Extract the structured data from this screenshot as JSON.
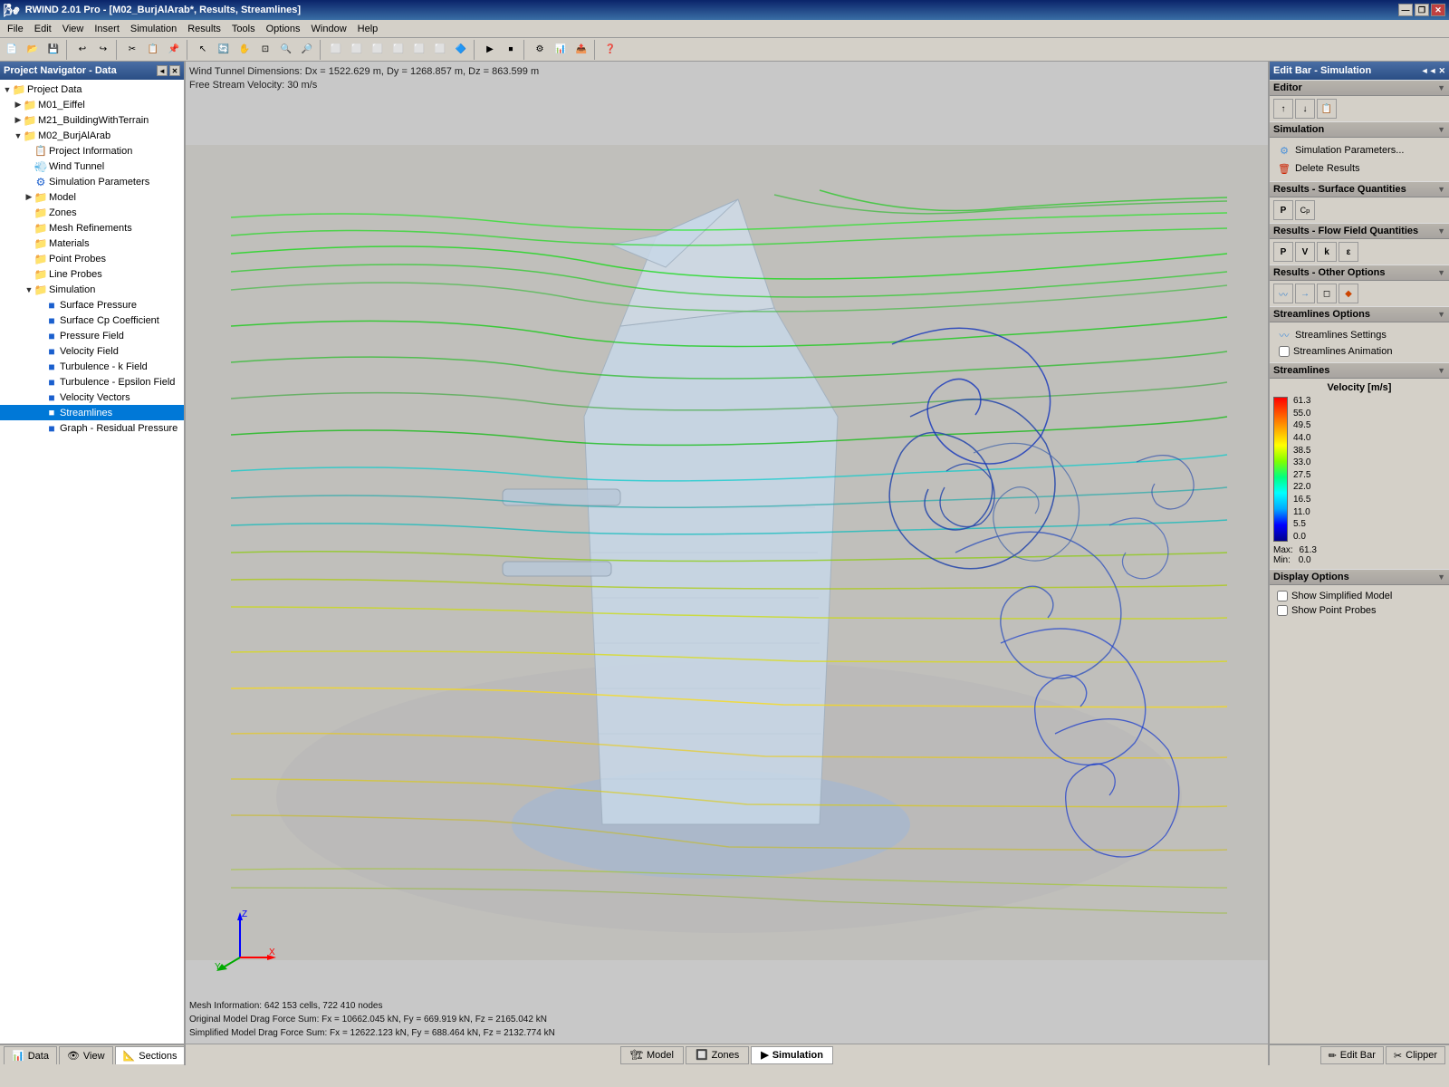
{
  "app": {
    "title": "RWIND 2.01 Pro - [M02_BurjAlArab*, Results, Streamlines]",
    "title_buttons": [
      "—",
      "❐",
      "✕"
    ]
  },
  "menu": {
    "items": [
      "File",
      "Edit",
      "View",
      "Insert",
      "Simulation",
      "Results",
      "Tools",
      "Options",
      "Window",
      "Help"
    ]
  },
  "left_panel": {
    "title": "Project Navigator - Data",
    "controls": [
      "◄",
      "✕"
    ]
  },
  "tree": {
    "items": [
      {
        "id": "project-data",
        "label": "Project Data",
        "indent": 0,
        "expand": "▼",
        "icon": "📁",
        "type": "folder"
      },
      {
        "id": "m01-eiffel",
        "label": "M01_Eiffel",
        "indent": 1,
        "expand": "▶",
        "icon": "📁",
        "type": "folder"
      },
      {
        "id": "m21-building",
        "label": "M21_BuildingWithTerrain",
        "indent": 1,
        "expand": "▶",
        "icon": "📁",
        "type": "folder"
      },
      {
        "id": "m02-burj",
        "label": "M02_BurjAlArab",
        "indent": 1,
        "expand": "▼",
        "icon": "📁",
        "type": "folder"
      },
      {
        "id": "project-info",
        "label": "Project Information",
        "indent": 2,
        "expand": "",
        "icon": "📋",
        "type": "info"
      },
      {
        "id": "wind-tunnel",
        "label": "Wind Tunnel",
        "indent": 2,
        "expand": "",
        "icon": "💨",
        "type": "wind"
      },
      {
        "id": "sim-params",
        "label": "Simulation Parameters",
        "indent": 2,
        "expand": "",
        "icon": "⚙",
        "type": "sim"
      },
      {
        "id": "model",
        "label": "Model",
        "indent": 2,
        "expand": "▶",
        "icon": "📁",
        "type": "folder"
      },
      {
        "id": "zones",
        "label": "Zones",
        "indent": 2,
        "expand": "",
        "icon": "📁",
        "type": "folder"
      },
      {
        "id": "mesh-refinements",
        "label": "Mesh Refinements",
        "indent": 2,
        "expand": "",
        "icon": "📁",
        "type": "folder"
      },
      {
        "id": "materials",
        "label": "Materials",
        "indent": 2,
        "expand": "",
        "icon": "📁",
        "type": "folder"
      },
      {
        "id": "point-probes",
        "label": "Point Probes",
        "indent": 2,
        "expand": "",
        "icon": "📁",
        "type": "folder"
      },
      {
        "id": "line-probes",
        "label": "Line Probes",
        "indent": 2,
        "expand": "",
        "icon": "📁",
        "type": "folder"
      },
      {
        "id": "simulation",
        "label": "Simulation",
        "indent": 2,
        "expand": "▼",
        "icon": "📁",
        "type": "folder"
      },
      {
        "id": "surface-pressure",
        "label": "Surface Pressure",
        "indent": 3,
        "expand": "",
        "icon": "■",
        "type": "result"
      },
      {
        "id": "surface-cp",
        "label": "Surface Cp Coefficient",
        "indent": 3,
        "expand": "",
        "icon": "■",
        "type": "result"
      },
      {
        "id": "pressure-field",
        "label": "Pressure Field",
        "indent": 3,
        "expand": "",
        "icon": "■",
        "type": "result"
      },
      {
        "id": "velocity-field",
        "label": "Velocity Field",
        "indent": 3,
        "expand": "",
        "icon": "■",
        "type": "result"
      },
      {
        "id": "turbulence-k",
        "label": "Turbulence - k Field",
        "indent": 3,
        "expand": "",
        "icon": "■",
        "type": "result"
      },
      {
        "id": "turbulence-eps",
        "label": "Turbulence - Epsilon Field",
        "indent": 3,
        "expand": "",
        "icon": "■",
        "type": "result"
      },
      {
        "id": "velocity-vectors",
        "label": "Velocity Vectors",
        "indent": 3,
        "expand": "",
        "icon": "■",
        "type": "result"
      },
      {
        "id": "streamlines",
        "label": "Streamlines",
        "indent": 3,
        "expand": "",
        "icon": "■",
        "type": "result",
        "selected": true
      },
      {
        "id": "graph-residual",
        "label": "Graph - Residual Pressure",
        "indent": 3,
        "expand": "",
        "icon": "■",
        "type": "result"
      }
    ]
  },
  "viewport": {
    "info_top_line1": "Wind Tunnel Dimensions: Dx = 1522.629 m, Dy = 1268.857 m, Dz = 863.599 m",
    "info_top_line2": "Free Stream Velocity: 30 m/s",
    "info_bottom_line1": "Mesh Information: 642 153 cells, 722 410 nodes",
    "info_bottom_line2": "Original Model Drag Force Sum: Fx = 10662.045 kN, Fy = 669.919 kN, Fz = 2165.042 kN",
    "info_bottom_line3": "Simplified Model Drag Force Sum: Fx = 12622.123 kN, Fy = 688.464 kN, Fz = 2132.774 kN"
  },
  "right_panel": {
    "title": "Edit Bar - Simulation",
    "controls": [
      "◄◄",
      "✕"
    ],
    "sections": {
      "editor": {
        "title": "Editor",
        "buttons": [
          "↑",
          "↓",
          "📋"
        ]
      },
      "simulation": {
        "title": "Simulation",
        "menu_items": [
          "Simulation Parameters...",
          "Delete Results"
        ]
      },
      "results_surface": {
        "title": "Results - Surface Quantities",
        "buttons": [
          "P",
          "Cp"
        ]
      },
      "results_flow": {
        "title": "Results - Flow Field Quantities",
        "buttons": [
          "P",
          "V",
          "k",
          "ε"
        ]
      },
      "results_other": {
        "title": "Results - Other Options",
        "buttons": [
          "🔵",
          "📊",
          "◻",
          "🔷"
        ]
      },
      "streamlines_options": {
        "title": "Streamlines Options",
        "items": [
          "Streamlines Settings",
          "Streamlines Animation"
        ]
      },
      "streamlines": {
        "title": "Streamlines",
        "legend": {
          "title": "Velocity [m/s]",
          "values": [
            "61.3",
            "55.0",
            "49.5",
            "44.0",
            "38.5",
            "33.0",
            "27.5",
            "22.0",
            "16.5",
            "11.0",
            "5.5",
            "0.0"
          ],
          "max_label": "Max:",
          "max_val": "61.3",
          "min_label": "Min:",
          "min_val": "0.0"
        }
      },
      "display_options": {
        "title": "Display Options",
        "checkboxes": [
          "Show Simplified Model",
          "Show Point Probes"
        ]
      }
    }
  },
  "bottom_left_tabs": [
    {
      "label": "Data",
      "icon": "📊",
      "active": false
    },
    {
      "label": "View",
      "icon": "👁",
      "active": false
    },
    {
      "label": "Sections",
      "icon": "📐",
      "active": true
    }
  ],
  "bottom_center_tabs": [
    {
      "label": "Model",
      "icon": "🏗",
      "active": false
    },
    {
      "label": "Zones",
      "icon": "🔲",
      "active": false
    },
    {
      "label": "Simulation",
      "icon": "▶",
      "active": true
    }
  ],
  "bottom_right_tabs": [
    {
      "label": "Edit Bar",
      "icon": "✏",
      "active": false
    },
    {
      "label": "Clipper",
      "icon": "✂",
      "active": false
    }
  ]
}
